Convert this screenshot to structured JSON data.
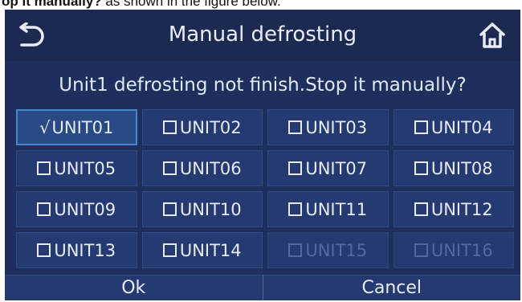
{
  "caption": {
    "bold": "op it manually?",
    "rest": " as shown in the figure below."
  },
  "header": {
    "title": "Manual defrosting",
    "back_icon": "back-arrow-icon",
    "home_icon": "home-icon"
  },
  "message": "Unit1 defrosting not finish.Stop it manually?",
  "units": [
    {
      "label": "UNIT01",
      "state": "checked"
    },
    {
      "label": "UNIT02",
      "state": "unchecked"
    },
    {
      "label": "UNIT03",
      "state": "unchecked"
    },
    {
      "label": "UNIT04",
      "state": "unchecked"
    },
    {
      "label": "UNIT05",
      "state": "unchecked"
    },
    {
      "label": "UNIT06",
      "state": "unchecked"
    },
    {
      "label": "UNIT07",
      "state": "unchecked"
    },
    {
      "label": "UNIT08",
      "state": "unchecked"
    },
    {
      "label": "UNIT09",
      "state": "unchecked"
    },
    {
      "label": "UNIT10",
      "state": "unchecked"
    },
    {
      "label": "UNIT11",
      "state": "unchecked"
    },
    {
      "label": "UNIT12",
      "state": "unchecked"
    },
    {
      "label": "UNIT13",
      "state": "unchecked"
    },
    {
      "label": "UNIT14",
      "state": "unchecked"
    },
    {
      "label": "UNIT15",
      "state": "disabled"
    },
    {
      "label": "UNIT16",
      "state": "disabled"
    }
  ],
  "check_mark": "√",
  "buttons": {
    "ok": "Ok",
    "cancel": "Cancel"
  },
  "colors": {
    "screen_bg": "#1e2f5e",
    "cell_bg": "#243a70",
    "text": "#e6ebf5",
    "disabled_text": "#53699d",
    "selected_border": "#4a87c9"
  }
}
